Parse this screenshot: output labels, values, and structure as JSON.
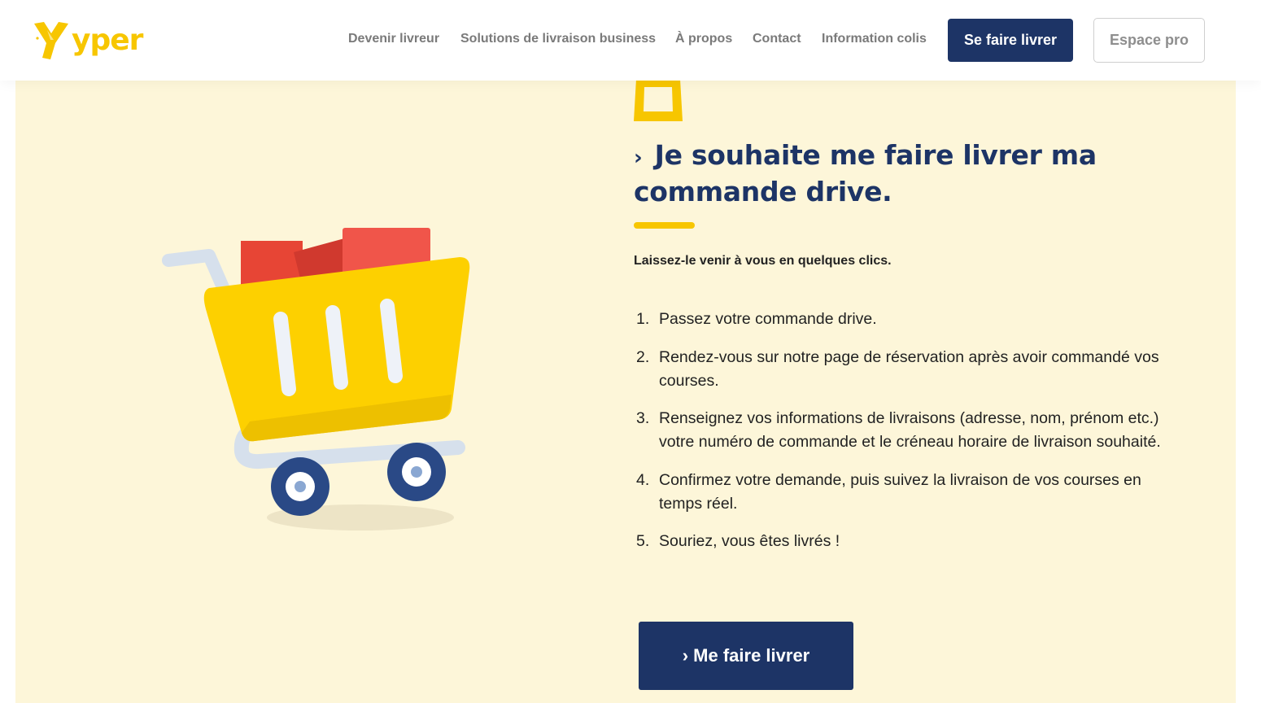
{
  "brand": {
    "name": "yper",
    "accent_color": "#f7c600",
    "primary_color": "#1d3466",
    "section_bg": "#fdf6d9"
  },
  "nav": {
    "links": [
      {
        "label": "Devenir livreur"
      },
      {
        "label": "Solutions de livraison business"
      },
      {
        "label": "À propos"
      },
      {
        "label": "Contact"
      },
      {
        "label": "Information colis"
      }
    ],
    "primary_button": "Se faire livrer",
    "secondary_button": "Espace pro"
  },
  "hero": {
    "icon": "shopping-bag-icon",
    "title_chevron": "›",
    "title": "Je souhaite me faire livrer ma commande drive.",
    "subtitle": "Laissez-le venir à vous en quelques clics.",
    "steps": [
      {
        "num": "1.",
        "text": "Passez votre commande drive."
      },
      {
        "num": "2.",
        "text": "Rendez-vous sur notre page de réservation après avoir commandé vos courses."
      },
      {
        "num": "3.",
        "text": "Renseignez vos informations de livraisons (adresse, nom, prénom etc.) votre numéro de commande et le créneau horaire de livraison souhaité."
      },
      {
        "num": "4.",
        "text": "Confirmez votre demande, puis suivez la livraison de vos courses en temps réel."
      },
      {
        "num": "5.",
        "text": "Souriez, vous êtes livrés !"
      }
    ],
    "cta_label": "› Me faire livrer",
    "illustration": "shopping-cart-illustration"
  }
}
